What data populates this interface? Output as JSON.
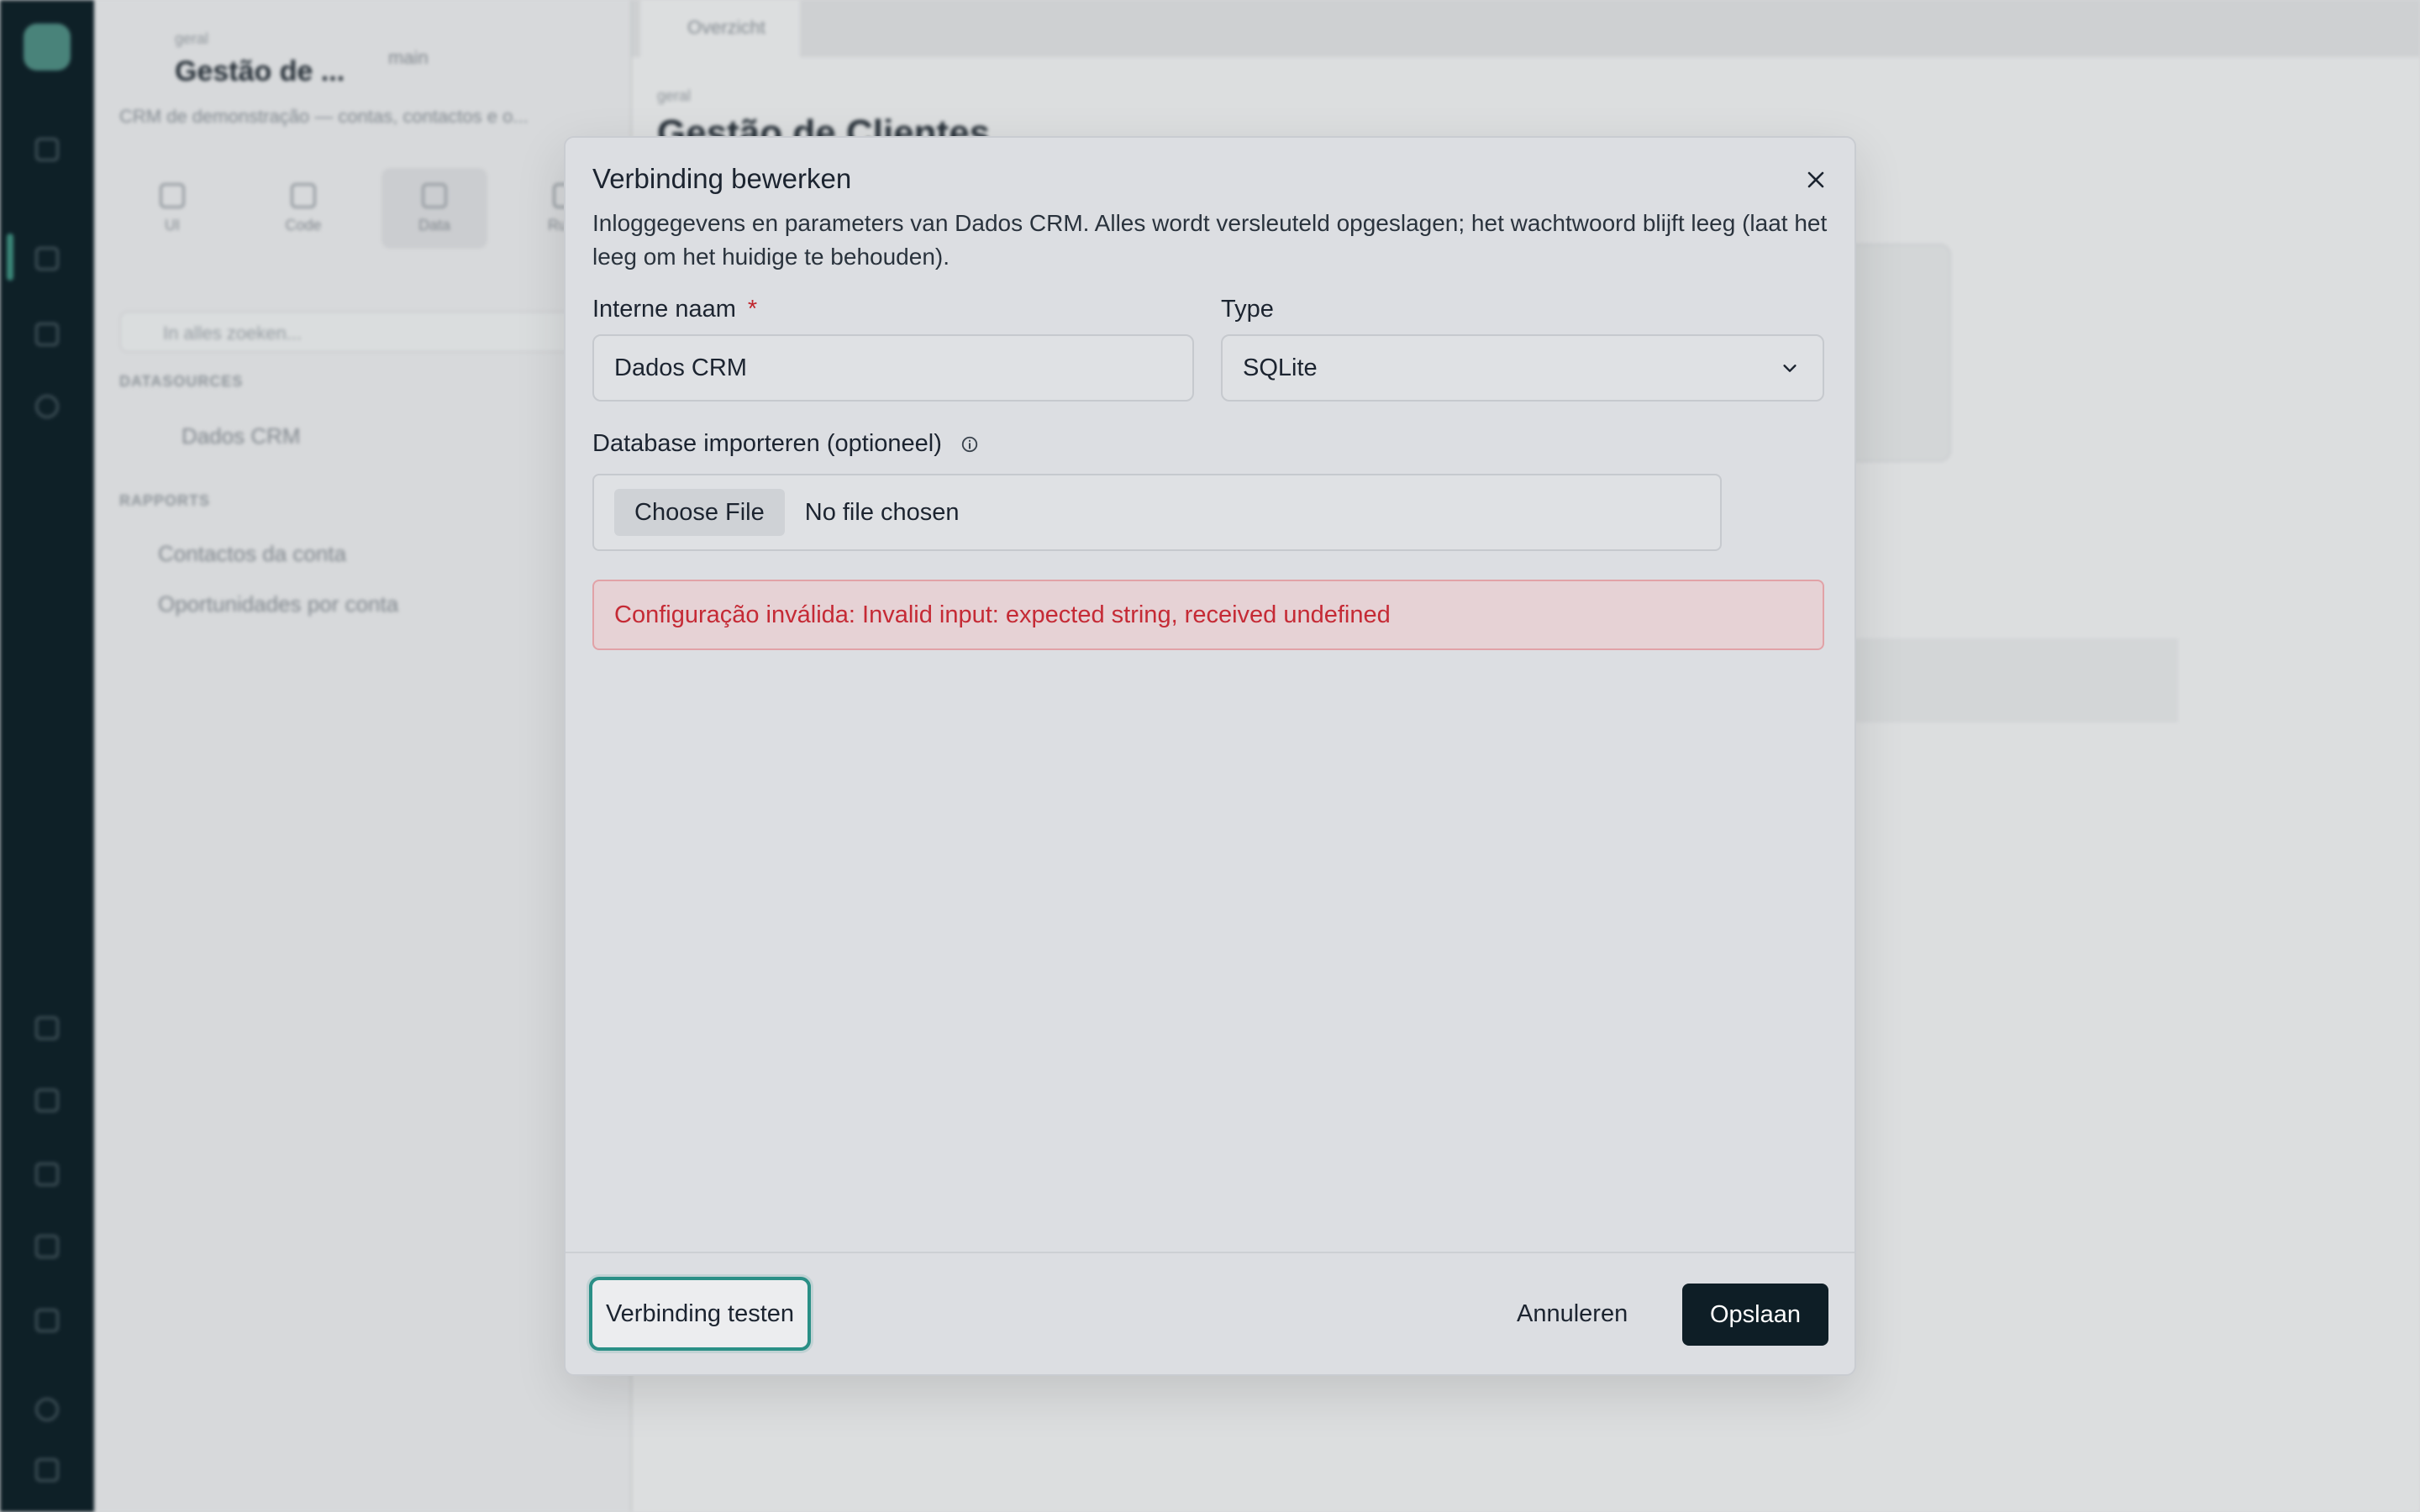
{
  "background": {
    "workspace_small": "geral",
    "workspace_title": "Gestão de ...",
    "workspace_subtitle": "CRM de demonstração — contas, contactos e o...",
    "branch": "main",
    "tabs": [
      "UI",
      "Code",
      "Data",
      "Runs"
    ],
    "search_placeholder": "In alles zoeken...",
    "sections": {
      "datasources": "DATASOURCES",
      "rapports": "RAPPORTS"
    },
    "datasource_item": "Dados CRM",
    "report_items": [
      "Contactos da conta",
      "Oportunidades por conta"
    ],
    "main_tab": "Overzicht",
    "main_crumb": "geral",
    "main_title": "Gestão de Clientes"
  },
  "dialog": {
    "title": "Verbinding bewerken",
    "description": "Inloggegevens en parameters van Dados CRM. Alles wordt versleuteld opgeslagen; het wachtwoord blijft leeg (laat het leeg om het huidige te behouden).",
    "name_label": "Interne naam",
    "required_mark": "*",
    "name_value": "Dados CRM",
    "type_label": "Type",
    "type_value": "SQLite",
    "import_label": "Database importeren (optioneel)",
    "file_button": "Choose File",
    "file_status": "No file chosen",
    "error": "Configuração inválida: Invalid input: expected string, received undefined",
    "test_button": "Verbinding testen",
    "cancel_button": "Annuleren",
    "save_button": "Opslaan"
  },
  "colors": {
    "accent_focus": "#2a8f86",
    "primary_button": "#0e1e26",
    "error_text": "#c52a35",
    "rail": "#0f2129"
  }
}
